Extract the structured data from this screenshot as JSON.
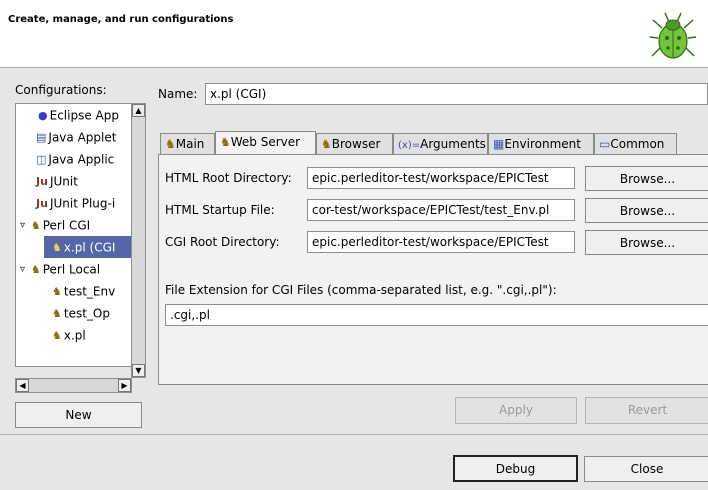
{
  "banner": {
    "title": "Create, manage, and run configurations",
    "logo_icon": "bug-icon"
  },
  "configurations": {
    "label": "Configurations:",
    "items": [
      {
        "label": "Eclipse App",
        "icon": "eclipse-app-icon",
        "expander": ""
      },
      {
        "label": "Java Applet",
        "icon": "java-applet-icon",
        "expander": ""
      },
      {
        "label": "Java Applic",
        "icon": "java-application-icon",
        "expander": ""
      },
      {
        "label": "JUnit",
        "icon": "junit-icon",
        "expander": ""
      },
      {
        "label": "JUnit Plug-i",
        "icon": "junit-plugin-icon",
        "expander": ""
      },
      {
        "label": "Perl CGI",
        "icon": "camel-icon",
        "expander": "▿"
      },
      {
        "label": "x.pl (CGI",
        "icon": "camel-cgi-icon",
        "expander": "",
        "selected": true
      },
      {
        "label": "Perl Local",
        "icon": "camel-icon",
        "expander": "▿"
      },
      {
        "label": "test_Env",
        "icon": "camel-icon",
        "expander": ""
      },
      {
        "label": "test_Op",
        "icon": "camel-icon",
        "expander": ""
      },
      {
        "label": "x.pl",
        "icon": "camel-icon",
        "expander": ""
      }
    ],
    "new_button": "New"
  },
  "name": {
    "label": "Name:",
    "value": "x.pl (CGI)"
  },
  "tabs": [
    {
      "label": "Main",
      "icon": "camel-icon"
    },
    {
      "label": "Web Server",
      "icon": "web-server-icon",
      "active": true
    },
    {
      "label": "Browser",
      "icon": "browser-icon"
    },
    {
      "label": "Arguments",
      "icon": "arguments-icon",
      "prefix": "(x)="
    },
    {
      "label": "Environment",
      "icon": "environment-icon"
    },
    {
      "label": "Common",
      "icon": "common-icon"
    }
  ],
  "web_server": {
    "html_root": {
      "label": "HTML Root Directory:",
      "value": "epic.perleditor-test/workspace/EPICTest",
      "button": "Browse..."
    },
    "html_startup": {
      "label": "HTML Startup File:",
      "value": "cor-test/workspace/EPICTest/test_Env.pl",
      "button": "Browse..."
    },
    "cgi_root": {
      "label": "CGI Root Directory:",
      "value": "epic.perleditor-test/workspace/EPICTest",
      "button": "Browse..."
    },
    "ext_label": "File Extension for CGI Files (comma-separated list, e.g. \".cgi,.pl\"):",
    "ext_value": ".cgi,.pl"
  },
  "actions": {
    "apply": "Apply",
    "revert": "Revert",
    "debug": "Debug",
    "close": "Close"
  }
}
